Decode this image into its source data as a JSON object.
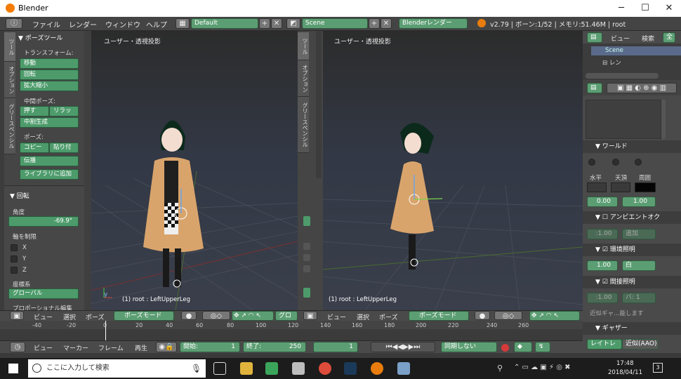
{
  "window": {
    "title": "Blender",
    "minimize": "─",
    "maximize": "☐",
    "close": "✕"
  },
  "infobar": {
    "menus": [
      "ファイル",
      "レンダー",
      "ウィンドウ",
      "ヘルプ"
    ],
    "layout": "Default",
    "scene": "Scene",
    "engine": "Blenderレンダー",
    "stats": "v2.79 | ボーン:1/52 | メモリ:51.46M | root"
  },
  "toolshelf": {
    "tabs": [
      "ツール",
      "オプション",
      "グリースペンシル"
    ],
    "panel_title": "ポーズツール",
    "transform_label": "トランスフォーム:",
    "move": "移動",
    "rotate": "回転",
    "scale": "拡大縮小",
    "inbetween_label": "中間ポーズ:",
    "push": "押す",
    "relax": "リラッ",
    "breakdowner": "中割生成",
    "pose_label": "ポーズ:",
    "copy": "コピー",
    "paste": "貼り付",
    "propagate": "伝播",
    "add_library": "ライブラリに追加"
  },
  "operator": {
    "title": "回転",
    "angle_label": "角度",
    "angle_value": "-69.9°",
    "constraint_label": "軸を制限",
    "axes": [
      "X",
      "Y",
      "Z"
    ],
    "orientation_label": "座標系",
    "orientation_value": "グローバル",
    "proportional": "プロポーショナル編集"
  },
  "viewport_left": {
    "title": "ユーザー・透視投影",
    "info": "(1) root : LeftUpperLeg"
  },
  "viewport_right": {
    "title": "ユーザー・透視投影",
    "info": "(1) root : LeftUpperLeg",
    "tabs": [
      "ツール",
      "オプション",
      "グリースペンシル"
    ]
  },
  "vp_header_left": {
    "menus": [
      "ビュー",
      "選択",
      "ポーズ"
    ],
    "mode": "ポーズモード",
    "pivot": "グロ"
  },
  "vp_header_right": {
    "menus": [
      "ビュー",
      "選択",
      "ポーズ"
    ],
    "mode": "ポーズモード"
  },
  "timeline": {
    "ticks": [
      "-40",
      "-20",
      "0",
      "20",
      "40",
      "60",
      "80",
      "100",
      "120",
      "140",
      "160",
      "180",
      "200",
      "220",
      "240",
      "260"
    ],
    "menus": [
      "ビュー",
      "マーカー",
      "フレーム",
      "再生"
    ],
    "start_label": "開始:",
    "start_value": "1",
    "end_label": "終了:",
    "end_value": "250",
    "current": "1",
    "sync": "同期しない"
  },
  "outliner": {
    "view": "ビュー",
    "search": "検索",
    "all": "全",
    "scene": "Scene",
    "renderlayers": "レン"
  },
  "properties": {
    "world": "ワールド",
    "horizon": "水平",
    "zenith": "天頂",
    "ambient": "周囲",
    "val1": "0.00",
    "val2": "1.00",
    "ao": "アンビエントオク",
    "ao_factor": ":1.00",
    "ao_blend": "追加",
    "env_light": "環境照明",
    "env_energy": "1.00",
    "env_color": "白",
    "indirect": "間接照明",
    "ind_energy": ":1.00",
    "ind_bounce": "バ: 1",
    "approx": "近似ギャ…能します",
    "gather": "ギャザー",
    "raytrace": "レイトレ",
    "approx_ao": "近似(AAO)",
    "colors": {
      "horizon": "#3a3a3a",
      "zenith": "#3a3a3a",
      "ambient": "#050505"
    }
  },
  "taskbar": {
    "search": "ここに入力して検索",
    "time": "17:48",
    "date": "2018/04/11",
    "notif": "3"
  },
  "colors": {
    "accent": "#5c9e73",
    "viewport": "#323845",
    "panel": "#454545"
  }
}
